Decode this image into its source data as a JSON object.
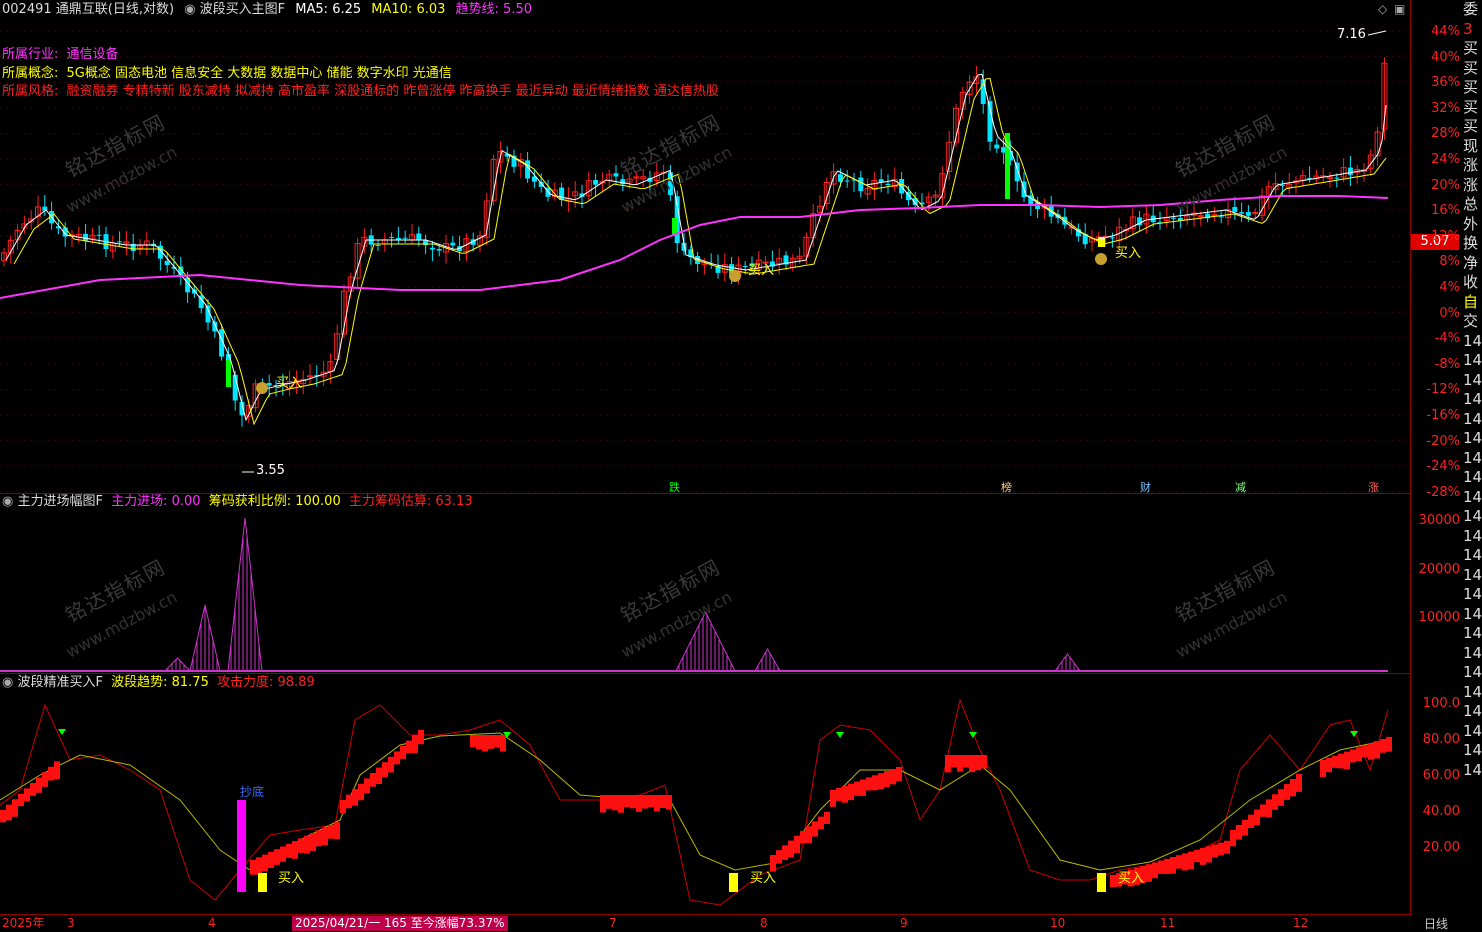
{
  "header": {
    "stock": "002491 通鼎互联(日线,对数)",
    "indicator": "波段买入主图F",
    "ma5": "MA5: 6.25",
    "ma10": "MA10: 6.03",
    "trend": "趋势线: 5.50"
  },
  "info": {
    "industry_label": "所属行业:",
    "industry": "通信设备",
    "concept_label": "所属概念:",
    "concepts": "5G概念 固态电池 信息安全 大数据 数据中心 储能 数字水印 光通信",
    "style_label": "所属风格:",
    "styles": "融资融券 专精特新 股东减持 拟减持 高市盈率 深股通标的 昨曾涨停 昨高换手 最近异动 最近情绪指数 通达信热股"
  },
  "price_labels": {
    "high": "7.16",
    "low": "3.55",
    "current": "5.07"
  },
  "markers": {
    "buy": "买入",
    "bottom": "抄底"
  },
  "event_tags": [
    "跌",
    "榜",
    "财",
    "减",
    "涨"
  ],
  "panel2": {
    "name": "主力进场幅图F",
    "inflow": "主力进场: 0.00",
    "profit": "筹码获利比例: 100.00",
    "estimate": "主力筹码估算: 63.13",
    "yticks": [
      "30000",
      "20000",
      "10000"
    ]
  },
  "panel3": {
    "name": "波段精准买入F",
    "trend": "波段趋势: 81.75",
    "attack": "攻击力度: 98.89",
    "yticks": [
      "100.0",
      "80.00",
      "60.00",
      "40.00",
      "20.00"
    ]
  },
  "yaxis_main": [
    "44%",
    "40%",
    "36%",
    "32%",
    "28%",
    "24%",
    "20%",
    "16%",
    "12%",
    "8%",
    "4%",
    "0%",
    "-4%",
    "-8%",
    "-12%",
    "-16%",
    "-20%",
    "-24%",
    "-28%"
  ],
  "right_panel": [
    "委",
    "3",
    "买",
    "买",
    "买",
    "买",
    "买",
    "现",
    "涨",
    "涨",
    "总",
    "外",
    "换",
    "净",
    "收",
    "自",
    "交",
    "14",
    "14",
    "14",
    "14",
    "14",
    "14",
    "14",
    "14",
    "14",
    "14",
    "14",
    "14",
    "14",
    "14",
    "14",
    "14",
    "14",
    "14",
    "14",
    "14",
    "14",
    "14",
    "14"
  ],
  "xaxis": {
    "year": "2025年",
    "months": [
      "3",
      "4",
      "7",
      "8",
      "9",
      "10",
      "11",
      "12"
    ],
    "cursor": "2025/04/21/一 165 至今涨幅73.37%",
    "period": "日线"
  },
  "watermark": {
    "cn": "铭达指标网",
    "url": "www.mdzbw.cn"
  },
  "colors": {
    "up": "#ff2020",
    "down": "#00e5ff",
    "ma5": "#ffffff",
    "ma10": "#ffff00",
    "trend": "#ff33ff",
    "grid": "#8b0000"
  }
}
